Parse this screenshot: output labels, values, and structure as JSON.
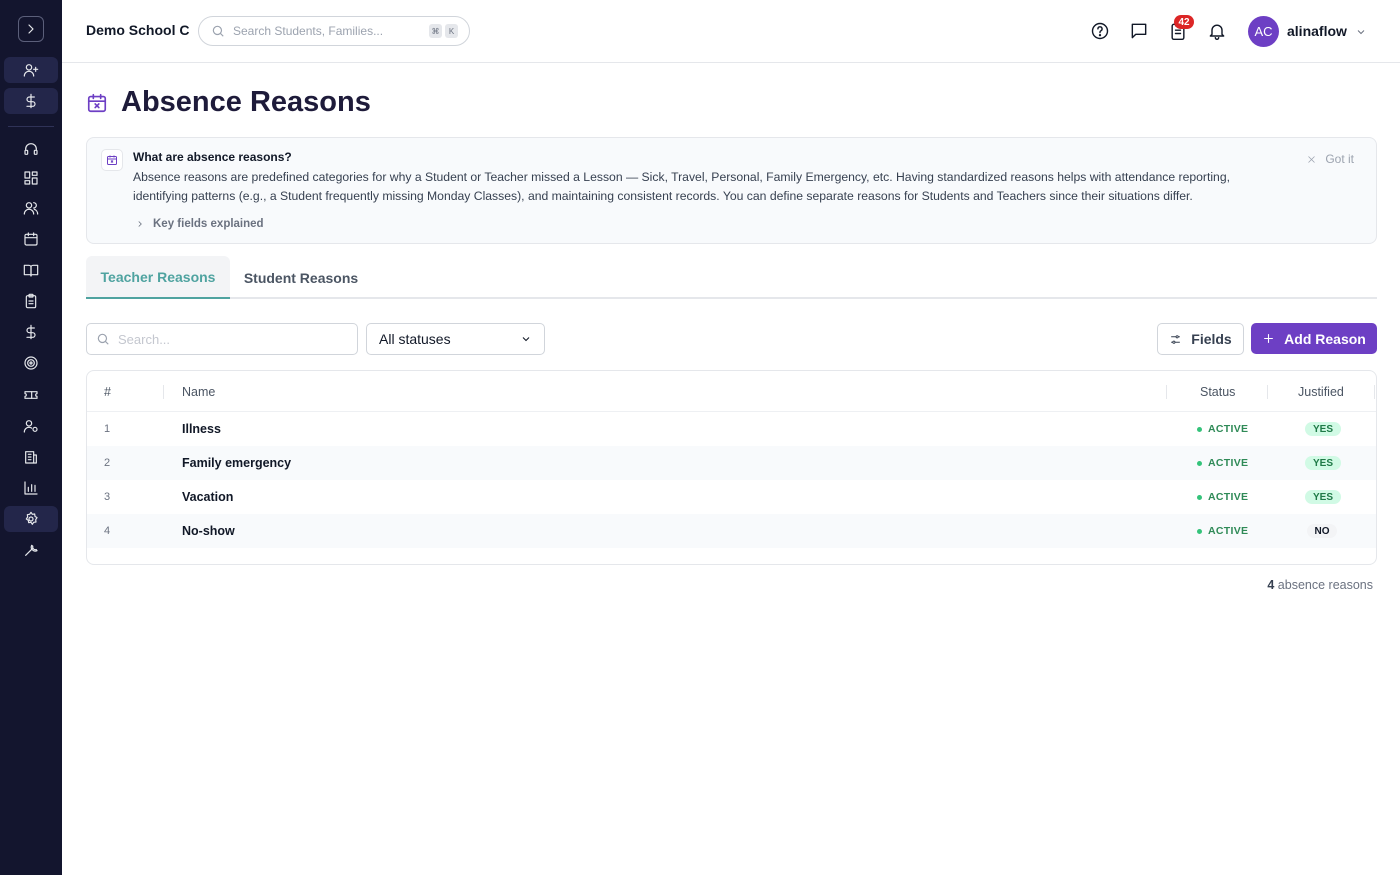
{
  "topbar": {
    "school_name": "Demo School C",
    "search_placeholder": "Search Students, Families...",
    "shortcut_keys": [
      "⌘",
      "K"
    ],
    "notification_count": "42",
    "user_initials": "AC",
    "username": "alinaflow"
  },
  "sidebar": {
    "items": [
      "add-user",
      "billing",
      "support",
      "dashboard",
      "people",
      "calendar",
      "courses",
      "tasks",
      "payments",
      "goals",
      "tickets",
      "user-settings",
      "buildings",
      "reports",
      "settings",
      "tools"
    ]
  },
  "page": {
    "title": "Absence Reasons"
  },
  "info": {
    "title": "What are absence reasons?",
    "body": "Absence reasons are predefined categories for why a Student or Teacher missed a Lesson — Sick, Travel, Personal, Family Emergency, etc. Having standardized reasons helps with attendance reporting, identifying patterns (e.g., a Student frequently missing Monday Classes), and maintaining consistent records. You can define separate reasons for Students and Teachers since their situations differ.",
    "key_fields": "Key fields explained",
    "dismiss": "Got it"
  },
  "tabs": {
    "teacher": "Teacher Reasons",
    "student": "Student Reasons"
  },
  "filters": {
    "search_placeholder": "Search...",
    "status_value": "All statuses",
    "fields_label": "Fields",
    "add_label": "Add Reason"
  },
  "table": {
    "headers": {
      "num": "#",
      "name": "Name",
      "status": "Status",
      "justified": "Justified"
    },
    "rows": [
      {
        "num": "1",
        "name": "Illness",
        "status": "ACTIVE",
        "justified": "YES"
      },
      {
        "num": "2",
        "name": "Family emergency",
        "status": "ACTIVE",
        "justified": "YES"
      },
      {
        "num": "3",
        "name": "Vacation",
        "status": "ACTIVE",
        "justified": "YES"
      },
      {
        "num": "4",
        "name": "No-show",
        "status": "ACTIVE",
        "justified": "NO"
      }
    ]
  },
  "footer": {
    "count": "4",
    "count_label": "absence reasons"
  },
  "colors": {
    "sidebar_bg": "#13152e",
    "accent_purple": "#6d3fc4",
    "active_tab": "#4fa3a0",
    "status_green": "#34c37a",
    "badge_red": "#dc2626"
  }
}
